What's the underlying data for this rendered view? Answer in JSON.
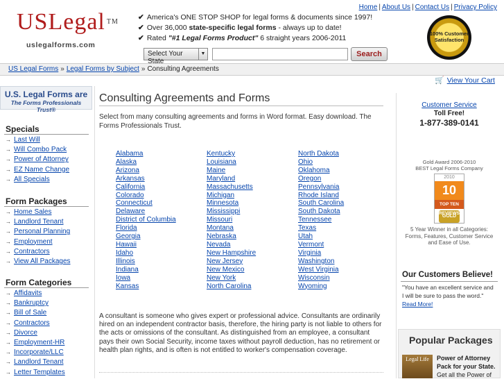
{
  "header": {
    "logo": "USLegal",
    "logo_tm": "TM",
    "logo_sub": "uslegalforms.com",
    "taglines": [
      {
        "pre": "America's ONE STOP SHOP for legal forms & documents since 1997!",
        "bold": "",
        "post": ""
      },
      {
        "pre": "Over 36,000 ",
        "bold": "state-specific legal forms",
        "post": " - always up to date!"
      },
      {
        "pre": "Rated ",
        "bold": "\"#1 Legal Forms Product\"",
        "post": " 6 straight years 2006-2011"
      }
    ],
    "toplinks": [
      "Home",
      "About Us",
      "Contact Us",
      "Privacy Policy"
    ],
    "state_select": "Select Your State",
    "search_button": "Search",
    "seal_text": "100% Customer Satisfaction"
  },
  "breadcrumb": [
    "US Legal Forms",
    "Legal Forms by Subject",
    "Consulting Agreements"
  ],
  "sidebar": {
    "trust_line1": "U.S. Legal Forms are",
    "trust_line2": "The Forms Professionals Trust®",
    "sections": [
      {
        "title": "Specials",
        "items": [
          "Last Will",
          "Will Combo Pack",
          "Power of Attorney",
          "EZ Name Change",
          "All Specials"
        ]
      },
      {
        "title": "Form Packages",
        "items": [
          "Home Sales",
          "Landlord Tenant",
          "Personal Planning",
          "Employment",
          "Contractors",
          "View All Packages"
        ]
      },
      {
        "title": "Form Categories",
        "items": [
          "Affidavits",
          "Bankruptcy",
          "Bill of Sale",
          "Contractors",
          "Divorce",
          "Employment-HR",
          "Incorporate/LLC",
          "Landlord Tenant",
          "Letter Templates"
        ]
      }
    ]
  },
  "main": {
    "title": "Consulting Agreements and Forms",
    "intro": "Select from many consulting agreements and forms in Word format. Easy download. The Forms Professionals Trust.",
    "states": [
      [
        "Alabama",
        "Alaska",
        "Arizona",
        "Arkansas",
        "California",
        "Colorado",
        "Connecticut",
        "Delaware",
        "District of Columbia",
        "Florida",
        "Georgia",
        "Hawaii",
        "Idaho",
        "Illinois",
        "Indiana",
        "Iowa",
        "Kansas"
      ],
      [
        "Kentucky",
        "Louisiana",
        "Maine",
        "Maryland",
        "Massachusetts",
        "Michigan",
        "Minnesota",
        "Mississippi",
        "Missouri",
        "Montana",
        "Nebraska",
        "Nevada",
        "New Hampshire",
        "New Jersey",
        "New Mexico",
        "New York",
        "North Carolina"
      ],
      [
        "North Dakota",
        "Ohio",
        "Oklahoma",
        "Oregon",
        "Pennsylvania",
        "Rhode Island",
        "South Carolina",
        "South Dakota",
        "Tennessee",
        "Texas",
        "Utah",
        "Vermont",
        "Virginia",
        "Washington",
        "West Virginia",
        "Wisconsin",
        "Wyoming"
      ]
    ],
    "description": "A consultant is someone who gives expert or professional advice. Consultants are ordinarily hired on an independent contractor basis, therefore, the hiring party is not liable to others for the acts or omissions of the consultant. As distinguished from an employee, a consultant pays their own Social Security, income taxes without payroll deduction, has no retirement or health plan rights, and is often is not entitled to worker's compensation coverage."
  },
  "right": {
    "cart": "View Your Cart",
    "customer_service": "Customer Service",
    "toll_free": "Toll Free!",
    "phone": "1-877-389-0141",
    "award_line1": "Gold Award 2006-2010",
    "award_line2": "BEST Legal Forms Company",
    "award_badge": {
      "year": "2010",
      "top": "10",
      "reviews": "TOP TEN REVIEWS",
      "gold": "GOLD AWARD"
    },
    "winner": "5 Year Winner in all Categories: Forms, Features, Customer Service and Ease of Use.",
    "believe_title": "Our Customers Believe!",
    "believe_quote": "\"You have an excellent service and I will be sure to pass the word.\"",
    "read_more": "Read More!",
    "popular_title": "Popular Packages",
    "popular_book": "Legal Life",
    "popular_item_bold": "Power of Attorney Pack for your State.",
    "popular_item_text": "Get all the Power of"
  }
}
